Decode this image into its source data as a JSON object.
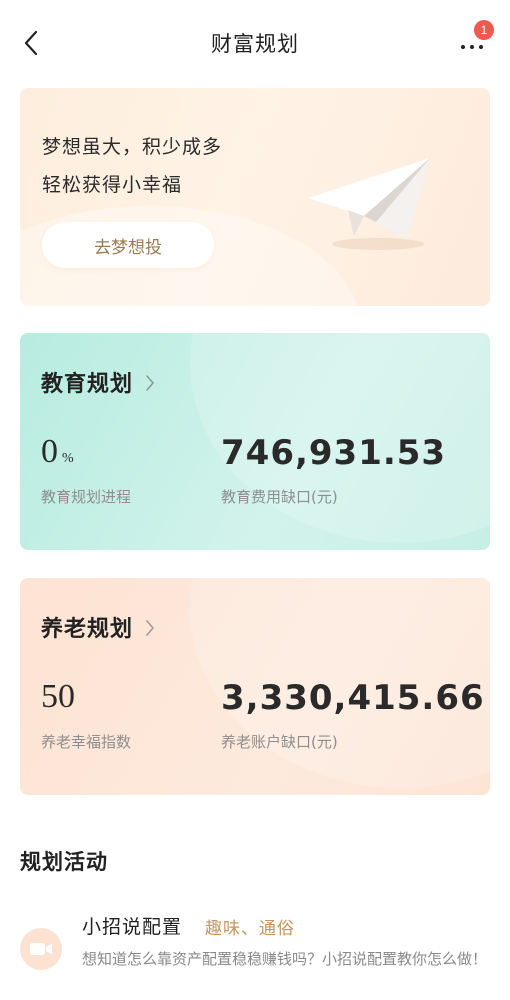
{
  "header": {
    "title": "财富规划",
    "badge_count": "1",
    "back_icon": "chevron-left-icon",
    "more_icon": "more-dots-icon"
  },
  "hero": {
    "line1": "梦想虽大，积少成多",
    "line2": "轻松获得小幸福",
    "button_label": "去梦想投",
    "illustration": "paper-plane-icon"
  },
  "education": {
    "title": "教育规划",
    "progress_value": "0",
    "progress_unit": "%",
    "progress_label": "教育规划进程",
    "gap_value": "746,931.53",
    "gap_label": "教育费用缺口(元)",
    "color": "#c6efe5"
  },
  "retirement": {
    "title": "养老规划",
    "index_value": "50",
    "index_label": "养老幸福指数",
    "gap_value": "3,330,415.66",
    "gap_label": "养老账户缺口(元)",
    "color": "#fde5d6"
  },
  "activities": {
    "section_title": "规划活动",
    "items": [
      {
        "title": "小招说配置",
        "tag": "趣味、通俗",
        "description": "想知道怎么靠资产配置稳稳赚钱吗？小招说配置教你怎么做！",
        "icon": "video-camera-icon"
      }
    ]
  },
  "colors": {
    "accent_text": "#c4955c",
    "badge": "#f0594d",
    "button_text": "#9b7a52"
  }
}
